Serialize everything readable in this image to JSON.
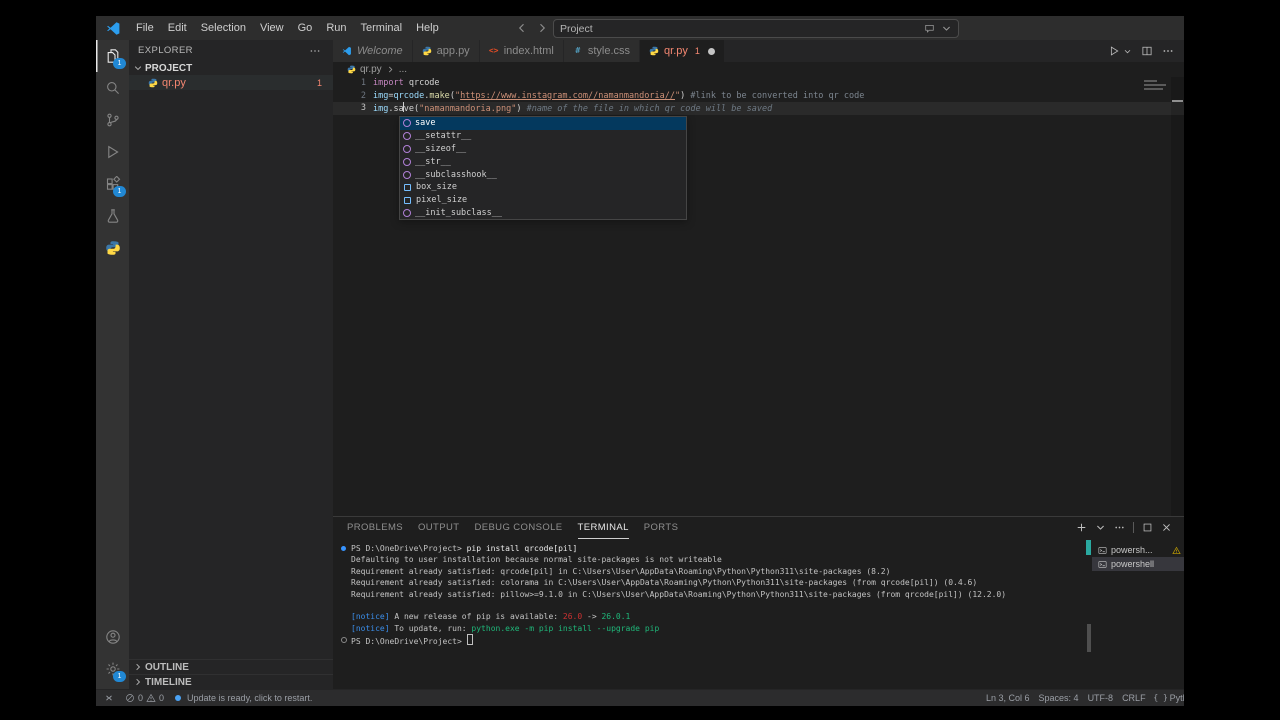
{
  "titlebar": {
    "menus": [
      "File",
      "Edit",
      "Selection",
      "View",
      "Go",
      "Run",
      "Terminal",
      "Help"
    ],
    "search_value": "Project"
  },
  "activity_bar": {
    "top": [
      {
        "name": "explorer",
        "icon": "files-icon",
        "badge": "1",
        "active": true
      },
      {
        "name": "search",
        "icon": "search-icon"
      },
      {
        "name": "source-control",
        "icon": "source-control-icon"
      },
      {
        "name": "run-and-debug",
        "icon": "debug-icon"
      },
      {
        "name": "extensions",
        "icon": "extensions-icon",
        "badge": "1"
      },
      {
        "name": "testing",
        "icon": "beaker-icon"
      },
      {
        "name": "python-extension",
        "icon": "python-icon"
      }
    ],
    "bottom": [
      {
        "name": "accounts",
        "icon": "account-icon"
      },
      {
        "name": "settings",
        "icon": "gear-icon",
        "badge": "1"
      }
    ]
  },
  "sidebar": {
    "title": "EXPLORER",
    "project_label": "PROJECT",
    "files": [
      {
        "name": "qr.py",
        "icon": "python-icon",
        "badge": "1",
        "error": true
      }
    ],
    "bottom_sections": [
      "OUTLINE",
      "TIMELINE"
    ]
  },
  "tabs": [
    {
      "label": "Welcome",
      "icon": "vscode-icon",
      "preview": true
    },
    {
      "label": "app.py",
      "icon": "python-icon"
    },
    {
      "label": "index.html",
      "icon": "html-icon"
    },
    {
      "label": "style.css",
      "icon": "css-icon"
    },
    {
      "label": "qr.py",
      "icon": "python-icon",
      "active": true,
      "error": true,
      "badge": "1",
      "dirty": true
    }
  ],
  "editor_actions": [
    {
      "name": "run-python-file-button",
      "icon": "play-icon"
    },
    {
      "name": "run-dropdown-button",
      "icon": "chevron-down-icon",
      "small": true
    },
    {
      "name": "split-editor-button",
      "icon": "split-icon"
    },
    {
      "name": "editor-more-actions-button",
      "icon": "ellipsis-icon"
    }
  ],
  "breadcrumb": {
    "file": "qr.py",
    "more": "..."
  },
  "editor": {
    "lines": [
      {
        "num": "1",
        "tokens": [
          {
            "t": "import",
            "c": "kw"
          },
          {
            "t": " qrcode",
            "c": "plain"
          }
        ]
      },
      {
        "num": "2",
        "tokens": [
          {
            "t": "img",
            "c": "var"
          },
          {
            "t": "=",
            "c": "plain"
          },
          {
            "t": "qrcode",
            "c": "var"
          },
          {
            "t": ".",
            "c": "plain"
          },
          {
            "t": "make",
            "c": "fn"
          },
          {
            "t": "(",
            "c": "plain"
          },
          {
            "t": "\"",
            "c": "str"
          },
          {
            "t": "https://www.instagram.com//namanmandoria//",
            "c": "str link"
          },
          {
            "t": "\"",
            "c": "str"
          },
          {
            "t": ")",
            "c": "plain"
          },
          {
            "t": " ",
            "c": "plain"
          },
          {
            "t": "#link to be converted into qr code",
            "c": "com"
          }
        ]
      },
      {
        "num": "3",
        "active": true,
        "tokens": [
          {
            "t": "img",
            "c": "var"
          },
          {
            "t": ".",
            "c": "plain"
          },
          {
            "t": "sa",
            "c": "plain"
          },
          {
            "cursor": true
          },
          {
            "t": "ve",
            "c": "plain"
          },
          {
            "t": "(",
            "c": "plain"
          },
          {
            "t": "\"namanmandoria.png\"",
            "c": "str"
          },
          {
            "t": ")",
            "c": "plain"
          },
          {
            "t": " ",
            "c": "plain"
          },
          {
            "t": "#name of the file in which qr code will be saved",
            "c": "com italic"
          }
        ]
      }
    ]
  },
  "suggest": {
    "items": [
      {
        "label": "save",
        "kind": "method",
        "selected": true
      },
      {
        "label": "__setattr__",
        "kind": "method"
      },
      {
        "label": "__sizeof__",
        "kind": "method"
      },
      {
        "label": "__str__",
        "kind": "method"
      },
      {
        "label": "__subclasshook__",
        "kind": "method"
      },
      {
        "label": "box_size",
        "kind": "field"
      },
      {
        "label": "pixel_size",
        "kind": "field"
      },
      {
        "label": "__init_subclass__",
        "kind": "method"
      }
    ]
  },
  "panel": {
    "tabs": [
      {
        "label": "PROBLEMS"
      },
      {
        "label": "OUTPUT"
      },
      {
        "label": "DEBUG CONSOLE"
      },
      {
        "label": "TERMINAL",
        "active": true
      },
      {
        "label": "PORTS"
      }
    ],
    "actions": [
      {
        "name": "new-terminal-button",
        "icon": "plus-icon"
      },
      {
        "name": "terminal-launch-dropdown",
        "icon": "chevron-down-icon"
      },
      {
        "name": "panel-more-actions-button",
        "icon": "ellipsis-icon"
      },
      {
        "name": "separator",
        "icon": "separator"
      },
      {
        "name": "maximize-panel-button",
        "icon": "maximize-icon"
      },
      {
        "name": "close-panel-button",
        "icon": "close-icon"
      }
    ],
    "terminal_lines": [
      {
        "deco": "dot-blue",
        "seg": [
          {
            "t": "PS D:\\OneDrive\\Project> ",
            "c": "plain"
          },
          {
            "t": "pip install qrcode[pil]",
            "c": "cmd"
          }
        ]
      },
      {
        "seg": [
          {
            "t": "Defaulting to user installation because normal site-packages is not writeable",
            "c": "plain"
          }
        ]
      },
      {
        "seg": [
          {
            "t": "Requirement already satisfied: qrcode[pil] in C:\\Users\\User\\AppData\\Roaming\\Python\\Python311\\site-packages (8.2)",
            "c": "plain"
          }
        ]
      },
      {
        "seg": [
          {
            "t": "Requirement already satisfied: colorama in C:\\Users\\User\\AppData\\Roaming\\Python\\Python311\\site-packages (from qrcode[pil]) (0.4.6)",
            "c": "plain"
          }
        ]
      },
      {
        "seg": [
          {
            "t": "Requirement already satisfied: pillow>=9.1.0 in C:\\Users\\User\\AppData\\Roaming\\Python\\Python311\\site-packages (from qrcode[pil]) (12.2.0)",
            "c": "plain"
          }
        ]
      },
      {
        "seg": []
      },
      {
        "seg": [
          {
            "t": "[notice]",
            "c": "cyan"
          },
          {
            "t": " A new release of pip is available: ",
            "c": "plain"
          },
          {
            "t": "26.0",
            "c": "red"
          },
          {
            "t": " -> ",
            "c": "plain"
          },
          {
            "t": "26.0.1",
            "c": "green"
          }
        ]
      },
      {
        "seg": [
          {
            "t": "[notice]",
            "c": "cyan"
          },
          {
            "t": " To update, run: ",
            "c": "plain"
          },
          {
            "t": "python.exe -m pip install --upgrade pip",
            "c": "green"
          }
        ]
      },
      {
        "deco": "circle",
        "cursor": true,
        "seg": [
          {
            "t": "PS D:\\OneDrive\\Project> ",
            "c": "plain"
          }
        ]
      }
    ],
    "terminal_list": [
      {
        "label": "powersh...",
        "icon": "terminal-icon",
        "warning": true
      },
      {
        "label": "powershell",
        "icon": "terminal-icon",
        "selected": true
      }
    ]
  },
  "status_bar": {
    "errors": "0",
    "warnings": "0",
    "update_message": "Update is ready, click to restart.",
    "right": [
      {
        "name": "cursor-position",
        "label": "Ln 3, Col 6"
      },
      {
        "name": "indentation",
        "label": "Spaces: 4"
      },
      {
        "name": "encoding",
        "label": "UTF-8"
      },
      {
        "name": "eol",
        "label": "CRLF"
      },
      {
        "name": "language-mode",
        "label": "Python",
        "icon": "braces-icon"
      }
    ]
  },
  "colors": {
    "accent": "#007acc",
    "badge": "#2188d4",
    "error": "#f48771",
    "warning": "#cca700"
  }
}
